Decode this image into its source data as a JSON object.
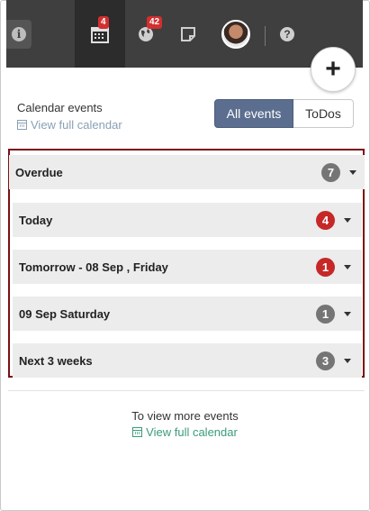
{
  "topbar": {
    "calendar_badge": "4",
    "globe_badge": "42",
    "info_icon": "info-icon",
    "help_icon": "help-icon"
  },
  "header": {
    "title": "Calendar events",
    "view_link": "View full calendar"
  },
  "toggle": {
    "all_label": "All events",
    "todos_label": "ToDos"
  },
  "add_button": "+",
  "events": [
    {
      "label": "Overdue",
      "count": "7",
      "color": "#757575"
    },
    {
      "label": "Today",
      "count": "4",
      "color": "#c62828"
    },
    {
      "label": "Tomorrow - 08 Sep , Friday",
      "count": "1",
      "color": "#c62828"
    },
    {
      "label": "09 Sep Saturday",
      "count": "1",
      "color": "#757575"
    },
    {
      "label": "Next 3 weeks",
      "count": "3",
      "color": "#757575"
    }
  ],
  "footer": {
    "text": "To view more events",
    "link": "View full calendar"
  },
  "colors": {
    "accent": "#5b6e8f",
    "highlight_border": "#7b1016",
    "link_green": "#3a9b7c"
  }
}
